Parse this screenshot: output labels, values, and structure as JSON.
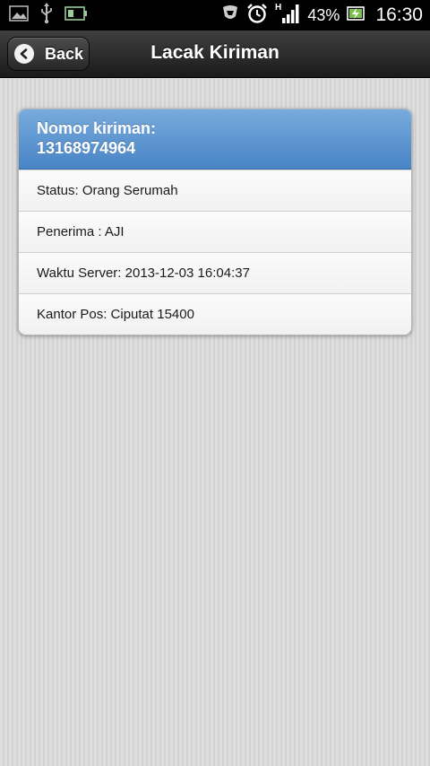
{
  "status_bar": {
    "battery_percent": "43%",
    "time": "16:30",
    "network": "H",
    "icons": [
      "image-icon",
      "usb-icon",
      "battery-outline-icon",
      "shield-icon",
      "alarm-clock-icon",
      "signal-icon",
      "battery-charging-icon"
    ]
  },
  "header": {
    "back_label": "Back",
    "title": "Lacak Kiriman"
  },
  "card": {
    "heading_label": "Nomor kiriman:",
    "tracking_number": "13168974964",
    "rows": [
      {
        "text": "Status: Orang Serumah"
      },
      {
        "text": "Penerima : AJI"
      },
      {
        "text": "Waktu Server: 2013-12-03 16:04:37"
      },
      {
        "text": "Kantor Pos: Ciputat 15400"
      }
    ]
  },
  "colors": {
    "header_bg": "#2a2a2a",
    "card_head_blue": "#5d95d1",
    "page_bg": "#d9d9d9"
  }
}
